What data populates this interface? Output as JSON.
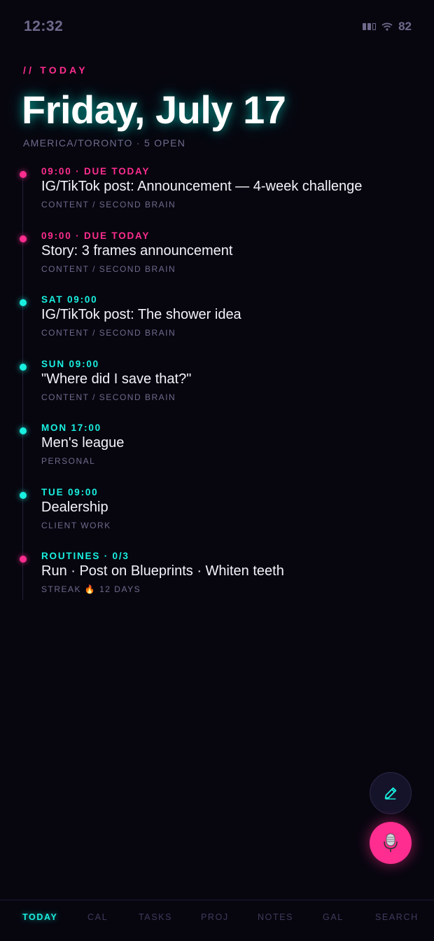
{
  "status": {
    "time": "12:32",
    "battery": "82"
  },
  "header": {
    "eyebrow": "// TODAY",
    "title": "Friday, July 17",
    "subtitle": "AMERICA/TORONTO · 5 OPEN"
  },
  "timeline": [
    {
      "when": "09:00",
      "sep": " · ",
      "flag": "DUE TODAY",
      "title": "IG/TikTok post: Announcement — 4-week challenge",
      "sub": "CONTENT / SECOND BRAIN",
      "dot": "pink"
    },
    {
      "when": "09:00",
      "sep": " · ",
      "flag": "DUE TODAY",
      "title": "Story: 3 frames announcement",
      "sub": "CONTENT / SECOND BRAIN",
      "dot": "pink"
    },
    {
      "when": "SAT 09:00",
      "title": "IG/TikTok post: The shower idea",
      "sub": "CONTENT / SECOND BRAIN",
      "dot": "cyan"
    },
    {
      "when": "SUN 09:00",
      "title": "\"Where did I save that?\"",
      "sub": "CONTENT / SECOND BRAIN",
      "dot": "cyan"
    },
    {
      "when": "MON 17:00",
      "title": "Men's league",
      "sub": "PERSONAL",
      "dot": "cyan"
    },
    {
      "when": "TUE 09:00",
      "title": "Dealership",
      "sub": "CLIENT WORK",
      "dot": "cyan"
    },
    {
      "when": "ROUTINES · 0/3",
      "title": "Run · Post on Blueprints · Whiten teeth",
      "sub": "STREAK 🔥 12 DAYS",
      "dot": "pink"
    }
  ],
  "fabs": {
    "edit_icon": "pencil-icon",
    "mic_icon": "microphone-icon"
  },
  "nav": {
    "today": "TODAY",
    "cal": "CAL",
    "tasks": "TASKS",
    "proj": "PROJ",
    "notes": "NOTES",
    "gal": "GAL",
    "search": "SEARCH"
  },
  "colors": {
    "accent_pink": "#ff2d8f",
    "accent_cyan": "#19f0e0",
    "background": "#07060f"
  }
}
